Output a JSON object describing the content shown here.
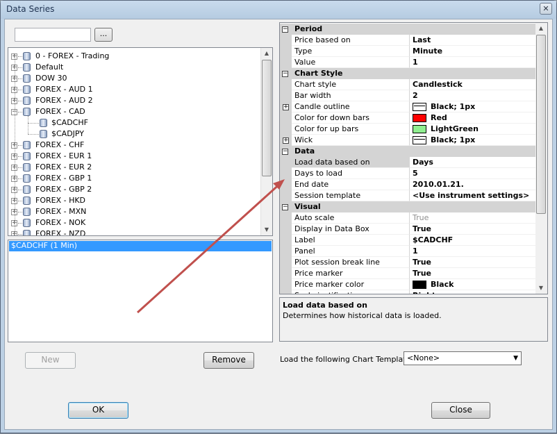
{
  "window": {
    "title": "Data Series",
    "close_glyph": "✕"
  },
  "search": {
    "value": "",
    "browse_label": "..."
  },
  "tree": {
    "items": [
      {
        "label": "0 - FOREX - Trading",
        "level": 0,
        "expander": "+"
      },
      {
        "label": "Default",
        "level": 0,
        "expander": "+"
      },
      {
        "label": "DOW 30",
        "level": 0,
        "expander": "+"
      },
      {
        "label": "FOREX - AUD 1",
        "level": 0,
        "expander": "+"
      },
      {
        "label": "FOREX - AUD 2",
        "level": 0,
        "expander": "+"
      },
      {
        "label": "FOREX - CAD",
        "level": 0,
        "expander": "−"
      },
      {
        "label": "$CADCHF",
        "level": 1,
        "expander": ""
      },
      {
        "label": "$CADJPY",
        "level": 1,
        "expander": ""
      },
      {
        "label": "FOREX - CHF",
        "level": 0,
        "expander": "+"
      },
      {
        "label": "FOREX - EUR 1",
        "level": 0,
        "expander": "+"
      },
      {
        "label": "FOREX - EUR 2",
        "level": 0,
        "expander": "+"
      },
      {
        "label": "FOREX - GBP 1",
        "level": 0,
        "expander": "+"
      },
      {
        "label": "FOREX - GBP 2",
        "level": 0,
        "expander": "+"
      },
      {
        "label": "FOREX - HKD",
        "level": 0,
        "expander": "+"
      },
      {
        "label": "FOREX - MXN",
        "level": 0,
        "expander": "+"
      },
      {
        "label": "FOREX - NOK",
        "level": 0,
        "expander": "+"
      },
      {
        "label": "FOREX - NZD",
        "level": 0,
        "expander": "+"
      }
    ]
  },
  "series_list": {
    "selected_item": "$CADCHF (1 Min)"
  },
  "buttons": {
    "new_label": "New",
    "remove_label": "Remove",
    "ok_label": "OK",
    "close_label": "Close"
  },
  "property_grid": {
    "rows": [
      {
        "kind": "category",
        "label": "Period",
        "expander": "−"
      },
      {
        "kind": "prop",
        "name": "Price based on",
        "value": "Last"
      },
      {
        "kind": "prop",
        "name": "Type",
        "value": "Minute"
      },
      {
        "kind": "prop",
        "name": "Value",
        "value": "1"
      },
      {
        "kind": "category",
        "label": "Chart Style",
        "expander": "−"
      },
      {
        "kind": "prop",
        "name": "Chart style",
        "value": "Candlestick"
      },
      {
        "kind": "prop",
        "name": "Bar width",
        "value": "2"
      },
      {
        "kind": "prop",
        "name": "Candle outline",
        "value": "Black; 1px",
        "swatch": "line",
        "expander": "+"
      },
      {
        "kind": "prop",
        "name": "Color for down bars",
        "value": "Red",
        "swatch": "#ff0000"
      },
      {
        "kind": "prop",
        "name": "Color for up bars",
        "value": "LightGreen",
        "swatch": "#90ee90"
      },
      {
        "kind": "prop",
        "name": "Wick",
        "value": "Black; 1px",
        "swatch": "line",
        "expander": "+"
      },
      {
        "kind": "category",
        "label": "Data",
        "expander": "−"
      },
      {
        "kind": "prop",
        "name": "Load data based on",
        "value": "Days",
        "selected": true
      },
      {
        "kind": "prop",
        "name": "Days to load",
        "value": "5"
      },
      {
        "kind": "prop",
        "name": "End date",
        "value": "2010.01.21."
      },
      {
        "kind": "prop",
        "name": "Session template",
        "value": "<Use instrument settings>"
      },
      {
        "kind": "category",
        "label": "Visual",
        "expander": "−"
      },
      {
        "kind": "prop",
        "name": "Auto scale",
        "value": "True",
        "dim": true
      },
      {
        "kind": "prop",
        "name": "Display in Data Box",
        "value": "True"
      },
      {
        "kind": "prop",
        "name": "Label",
        "value": "$CADCHF"
      },
      {
        "kind": "prop",
        "name": "Panel",
        "value": "1"
      },
      {
        "kind": "prop",
        "name": "Plot session break line",
        "value": "True"
      },
      {
        "kind": "prop",
        "name": "Price marker",
        "value": "True"
      },
      {
        "kind": "prop",
        "name": "Price marker color",
        "value": "Black",
        "swatch": "#000000"
      },
      {
        "kind": "prop",
        "name": "Scale justification",
        "value": "Right"
      }
    ]
  },
  "description": {
    "title": "Load data based on",
    "text": "Determines how historical data is loaded."
  },
  "template": {
    "label": "Load the following Chart Template:",
    "selected": "<None>"
  },
  "annotation": {
    "arrow_color": "#c0504d"
  }
}
